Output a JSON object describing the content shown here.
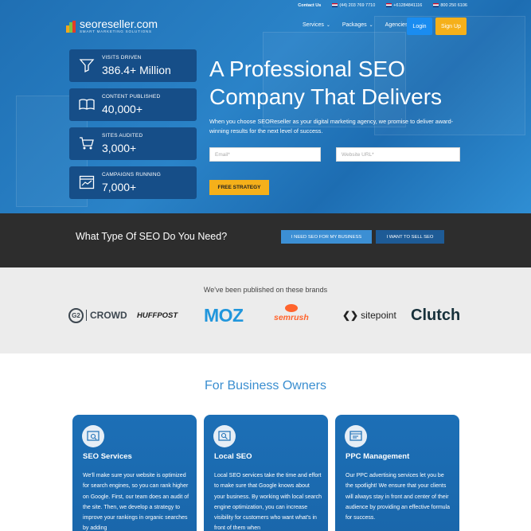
{
  "topbar": {
    "contact_label": "Contact Us",
    "phones": [
      "(44) 203 769 7710",
      "+61284841116",
      "800 250 6106"
    ]
  },
  "logo": {
    "name": "seoreseller.com",
    "tagline": "SMART MARKETING SOLUTIONS"
  },
  "nav": {
    "items": [
      {
        "label": "Services"
      },
      {
        "label": "Packages"
      },
      {
        "label": "Agencies"
      }
    ],
    "login_label": "Login",
    "signup_label": "Sign Up"
  },
  "stats": [
    {
      "label": "VISITS DRIVEN",
      "value": "386.4+ Million",
      "icon": "funnel-icon"
    },
    {
      "label": "CONTENT PUBLISHED",
      "value": "40,000+",
      "icon": "book-icon"
    },
    {
      "label": "SITES AUDITED",
      "value": "3,000+",
      "icon": "cart-icon"
    },
    {
      "label": "CAMPAIGNS RUNNING",
      "value": "7,000+",
      "icon": "chart-window-icon"
    }
  ],
  "hero": {
    "title": "A Professional SEO Company That Delivers",
    "description": "When you choose SEOReseller as your digital marketing agency, we promise to deliver award-winning results for the next level of success.",
    "email_placeholder": "Email*",
    "website_placeholder": "Website URL*",
    "cta_label": "FREE STRATEGY"
  },
  "seo_type": {
    "question": "What Type Of SEO Do You Need?",
    "business_button": "I NEED SEO FOR MY BUSINESS",
    "sell_button": "I WANT TO SELL SEO"
  },
  "brands": {
    "heading": "We've been published on these brands",
    "logos": {
      "crowd_g2": "G2",
      "crowd": "CROWD",
      "huffpost": "HUFFPOST",
      "moz": "MOZ",
      "semrush": "semrush",
      "sitepoint": "sitepoint",
      "clutch": "Clutch"
    }
  },
  "business": {
    "title": "For Business Owners",
    "cards": [
      {
        "title": "SEO Services",
        "body": "We'll make sure your website is optimized for search engines, so you can rank higher on Google. First, our team does an audit of the site. Then, we develop a strategy to improve your rankings in organic searches by adding",
        "icon": "seo-magnifier-icon"
      },
      {
        "title": "Local SEO",
        "body": "Local SEO services take the time and effort to make sure that Google knows about your business. By working with local search engine optimization, you can increase visibility for customers who want what's in front of them when",
        "icon": "local-search-icon"
      },
      {
        "title": "PPC Management",
        "body": "Our PPC advertising services let you be the spotlight! We ensure that your clients will always stay in front and center of their audience by providing an effective formula for success.",
        "icon": "ppc-window-icon"
      }
    ]
  },
  "colors": {
    "hero_blue": "#2a83c8",
    "stat_box": "#164e88",
    "accent_yellow": "#f5b01a",
    "login_blue": "#1a8cf0",
    "dark_band": "#2d2d2d",
    "section_title_blue": "#3a8ed0"
  }
}
